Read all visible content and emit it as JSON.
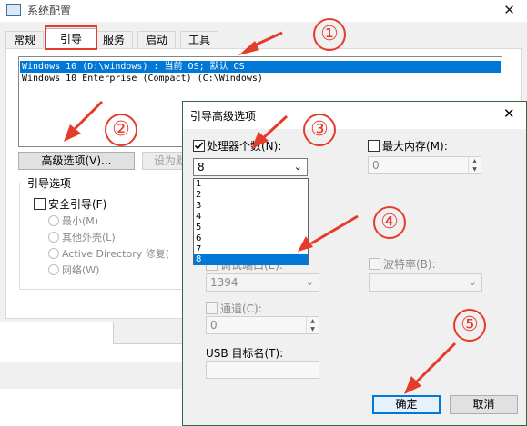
{
  "sys": {
    "title": "系统配置",
    "tabs": [
      "常规",
      "引导",
      "服务",
      "启动",
      "工具"
    ],
    "os_entries": [
      "Windows 10 (D:\\windows) : 当前 OS; 默认 OS",
      "Windows 10 Enterprise (Compact) (C:\\Windows)"
    ],
    "advanced_button": "高级选项(V)...",
    "set_default_button": "设为默",
    "boot_options_label": "引导选项",
    "safe_boot": "安全引导(F)",
    "radios": [
      "最小(M)",
      "其他外壳(L)",
      "Active Directory 修复(",
      "网络(W)"
    ]
  },
  "adv": {
    "title": "引导高级选项",
    "close": "✕",
    "num_proc_label": "处理器个数(N):",
    "num_proc_value": "8",
    "num_proc_options": [
      "1",
      "2",
      "3",
      "4",
      "5",
      "6",
      "7",
      "8"
    ],
    "max_mem_label": "最大内存(M):",
    "max_mem_value": "0",
    "debug_port_label": "调试端口(E):",
    "debug_port_value": "1394",
    "baud_label": "波特率(B):",
    "channel_label": "通道(C):",
    "channel_value": "0",
    "usb_label": "USB 目标名(T):",
    "ok": "确定",
    "cancel": "取消"
  },
  "annotations": {
    "color": "#e53b2a",
    "labels": [
      "①",
      "②",
      "③",
      "④",
      "⑤"
    ]
  }
}
